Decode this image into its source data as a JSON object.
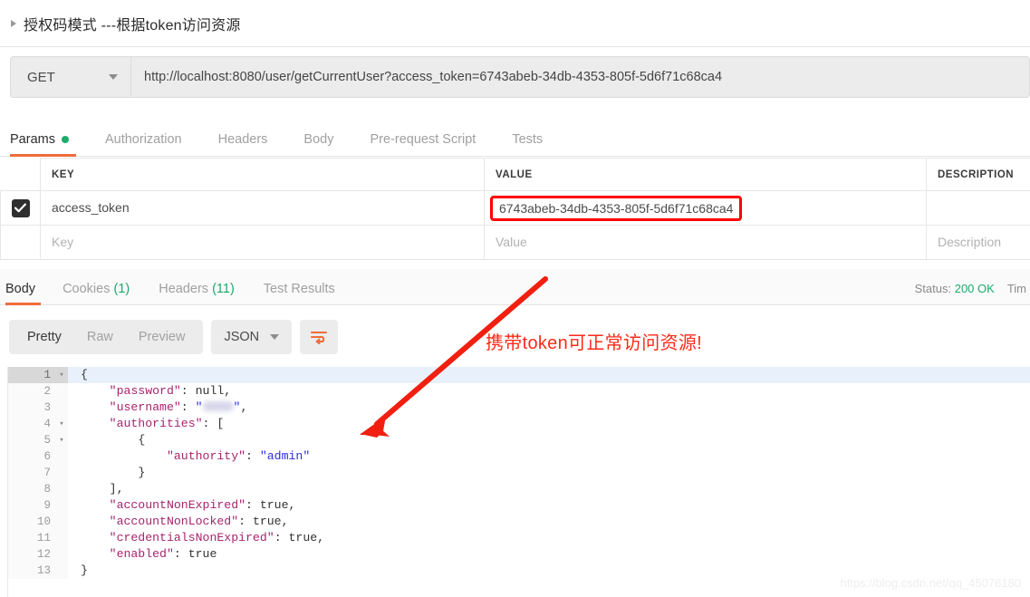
{
  "request_title": {
    "text": "授权码模式 ---根据token访问资源",
    "collapse_icon": "triangle-right-icon"
  },
  "url_bar": {
    "method": "GET",
    "method_caret": "chevron-down-icon",
    "url": "http://localhost:8080/user/getCurrentUser?access_token=6743abeb-34db-4353-805f-5d6f71c68ca4"
  },
  "request_tabs": [
    {
      "label": "Params",
      "active": true,
      "dot": true
    },
    {
      "label": "Authorization",
      "active": false,
      "dot": false
    },
    {
      "label": "Headers",
      "active": false,
      "dot": false
    },
    {
      "label": "Body",
      "active": false,
      "dot": false
    },
    {
      "label": "Pre-request Script",
      "active": false,
      "dot": false
    },
    {
      "label": "Tests",
      "active": false,
      "dot": false
    }
  ],
  "params_table": {
    "headers": {
      "key": "KEY",
      "value": "VALUE",
      "description": "DESCRIPTION"
    },
    "rows": [
      {
        "checked": true,
        "key": "access_token",
        "value": "6743abeb-34db-4353-805f-5d6f71c68ca4",
        "value_highlighted": true,
        "description": ""
      }
    ],
    "placeholder_row": {
      "key": "Key",
      "value": "Value",
      "description": "Description"
    }
  },
  "response_tabs": [
    {
      "label": "Body",
      "count": "",
      "active": true
    },
    {
      "label": "Cookies",
      "count": "(1)",
      "active": false
    },
    {
      "label": "Headers",
      "count": "(11)",
      "active": false
    },
    {
      "label": "Test Results",
      "count": "",
      "active": false
    }
  ],
  "response_status": {
    "status_label": "Status:",
    "status_value": "200 OK",
    "time_label": "Tim"
  },
  "format_bar": {
    "segments": [
      {
        "label": "Pretty",
        "active": true
      },
      {
        "label": "Raw",
        "active": false
      },
      {
        "label": "Preview",
        "active": false
      }
    ],
    "type": "JSON",
    "type_caret": "chevron-down-icon",
    "wrap_icon": "word-wrap-icon"
  },
  "code": {
    "lines": [
      {
        "num": "1",
        "fold": "▾",
        "highlight": true,
        "html": "{"
      },
      {
        "num": "2",
        "fold": "",
        "highlight": false,
        "html": "    <span class='k'>\"password\"</span><span class='p'>: </span><span class='v'>null</span><span class='p'>,</span>"
      },
      {
        "num": "3",
        "fold": "",
        "highlight": false,
        "html": "    <span class='k'>\"username\"</span><span class='p'>: </span><span class='s'>\"</span><span class='blur-val'></span><span class='s'>\"</span><span class='p'>,</span>"
      },
      {
        "num": "4",
        "fold": "▾",
        "highlight": false,
        "html": "    <span class='k'>\"authorities\"</span><span class='p'>: [</span>"
      },
      {
        "num": "5",
        "fold": "▾",
        "highlight": false,
        "html": "        <span class='p'>{</span>"
      },
      {
        "num": "6",
        "fold": "",
        "highlight": false,
        "html": "            <span class='k'>\"authority\"</span><span class='p'>: </span><span class='s'>\"admin\"</span>"
      },
      {
        "num": "7",
        "fold": "",
        "highlight": false,
        "html": "        <span class='p'>}</span>"
      },
      {
        "num": "8",
        "fold": "",
        "highlight": false,
        "html": "    <span class='p'>],</span>"
      },
      {
        "num": "9",
        "fold": "",
        "highlight": false,
        "html": "    <span class='k'>\"accountNonExpired\"</span><span class='p'>: </span><span class='v'>true</span><span class='p'>,</span>"
      },
      {
        "num": "10",
        "fold": "",
        "highlight": false,
        "html": "    <span class='k'>\"accountNonLocked\"</span><span class='p'>: </span><span class='v'>true</span><span class='p'>,</span>"
      },
      {
        "num": "11",
        "fold": "",
        "highlight": false,
        "html": "    <span class='k'>\"credentialsNonExpired\"</span><span class='p'>: </span><span class='v'>true</span><span class='p'>,</span>"
      },
      {
        "num": "12",
        "fold": "",
        "highlight": false,
        "html": "    <span class='k'>\"enabled\"</span><span class='p'>: </span><span class='v'>true</span>"
      },
      {
        "num": "13",
        "fold": "",
        "highlight": false,
        "html": "<span class='p'>}</span>"
      }
    ]
  },
  "annotation": {
    "text": "携带token可正常访问资源!",
    "color": "#ff2a1a",
    "arrow": "red-arrow-icon"
  },
  "watermark": "https://blog.csdn.net/qq_45076180",
  "colors": {
    "accent_orange": "#ef6c3b",
    "success_green": "#1bab6c",
    "annotation_red": "#ff0000"
  }
}
